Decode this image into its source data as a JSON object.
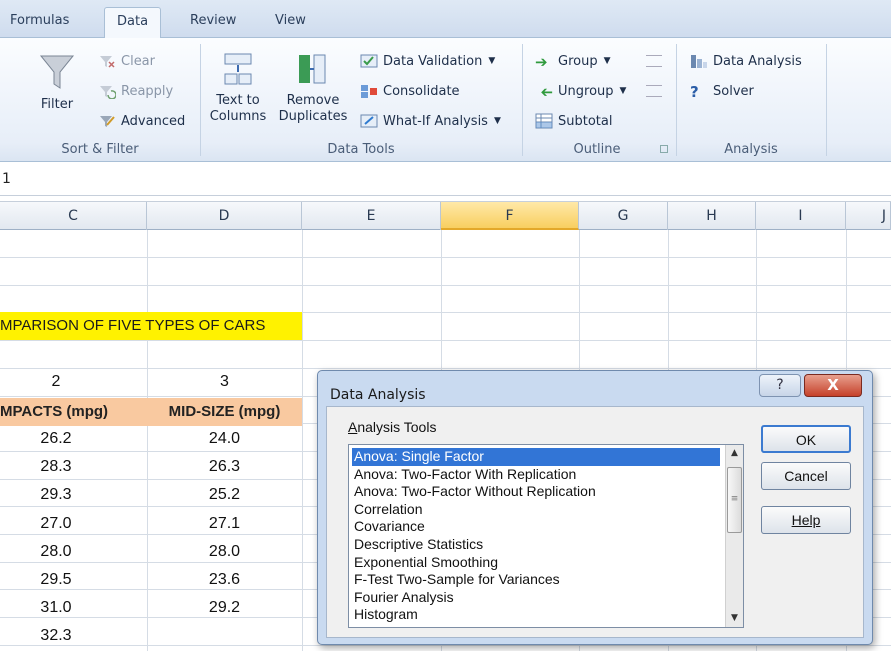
{
  "tabs": [
    {
      "label": "Formulas"
    },
    {
      "label": "Data"
    },
    {
      "label": "Review"
    },
    {
      "label": "View"
    }
  ],
  "ribbon": {
    "sort_filter": {
      "filter": "Filter",
      "clear": "Clear",
      "reapply": "Reapply",
      "advanced": "Advanced",
      "label": "Sort & Filter"
    },
    "data_tools": {
      "text_to_columns": "Text to\nColumns",
      "remove_duplicates": "Remove\nDuplicates",
      "data_validation": "Data Validation",
      "consolidate": "Consolidate",
      "what_if": "What-If Analysis",
      "label": "Data Tools"
    },
    "outline": {
      "group": "Group",
      "ungroup": "Ungroup",
      "subtotal": "Subtotal",
      "label": "Outline"
    },
    "analysis": {
      "data_analysis": "Data Analysis",
      "solver": "Solver",
      "label": "Analysis"
    }
  },
  "formula_bar": {
    "name_box": "1"
  },
  "columns": [
    "C",
    "D",
    "E",
    "F",
    "G",
    "H",
    "I",
    "J"
  ],
  "sheet": {
    "title": "MPARISON OF FIVE TYPES OF CARS",
    "col_c_number": "2",
    "col_d_number": "3",
    "col_c_header": "MPACTS (mpg)",
    "col_d_header": "MID-SIZE (mpg)",
    "col_c_values": [
      "26.2",
      "28.3",
      "29.3",
      "27.0",
      "28.0",
      "29.5",
      "31.0",
      "32.3"
    ],
    "col_d_values": [
      "24.0",
      "26.3",
      "25.2",
      "27.1",
      "28.0",
      "23.6",
      "29.2"
    ]
  },
  "dialog": {
    "title": "Data Analysis",
    "help_glyph": "?",
    "close_glyph": "X",
    "list_label_first": "A",
    "list_label_rest": "nalysis Tools",
    "tools": [
      "Anova: Single Factor",
      "Anova: Two-Factor With Replication",
      "Anova: Two-Factor Without Replication",
      "Correlation",
      "Covariance",
      "Descriptive Statistics",
      "Exponential Smoothing",
      "F-Test Two-Sample for Variances",
      "Fourier Analysis",
      "Histogram"
    ],
    "selected_tool": "Anova: Single Factor",
    "ok": "OK",
    "cancel": "Cancel",
    "help": "Help"
  }
}
